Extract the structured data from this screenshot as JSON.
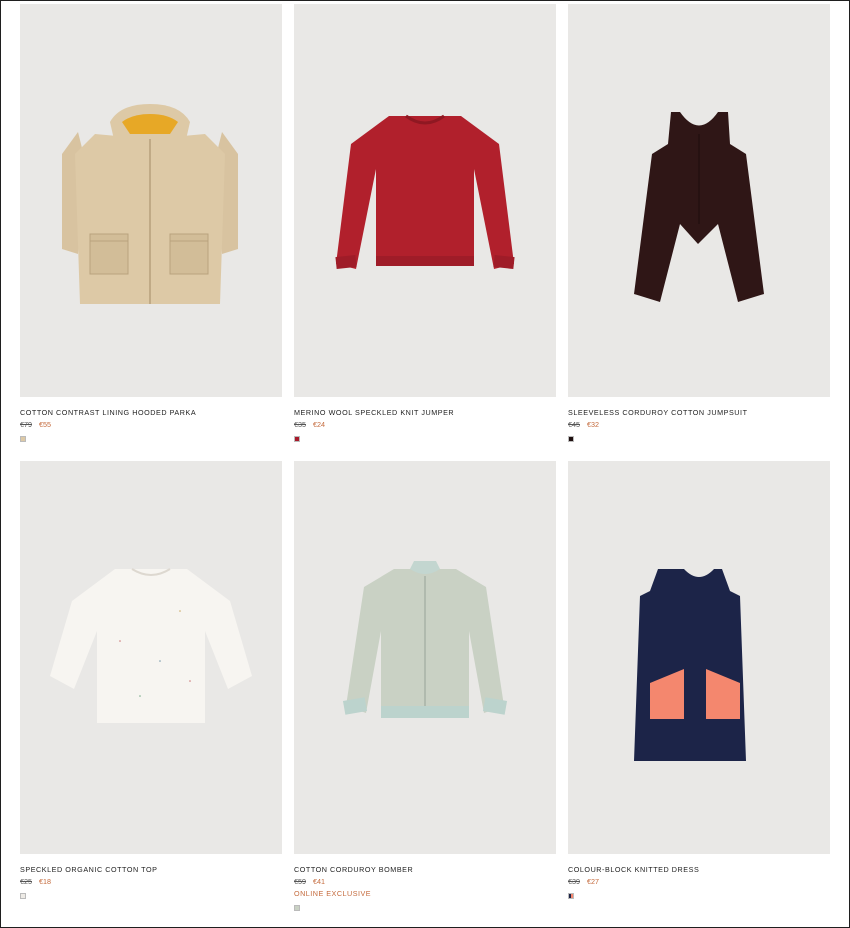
{
  "products": [
    {
      "name": "COTTON CONTRAST LINING HOODED PARKA",
      "old_price": "€79",
      "new_price": "€55",
      "badge": "",
      "swatch": "#ddc9a6",
      "icon": "parka-image"
    },
    {
      "name": "MERINO WOOL SPECKLED KNIT JUMPER",
      "old_price": "€35",
      "new_price": "€24",
      "badge": "",
      "swatch": "#a8192a",
      "icon": "jumper-image"
    },
    {
      "name": "SLEEVELESS CORDUROY COTTON JUMPSUIT",
      "old_price": "€45",
      "new_price": "€32",
      "badge": "",
      "swatch": "#1e0f0f",
      "icon": "jumpsuit-image"
    },
    {
      "name": "SPECKLED ORGANIC COTTON TOP",
      "old_price": "€25",
      "new_price": "€18",
      "badge": "",
      "swatch": "#eeebe6",
      "icon": "top-image"
    },
    {
      "name": "COTTON CORDUROY BOMBER",
      "old_price": "€59",
      "new_price": "€41",
      "badge": "ONLINE EXCLUSIVE",
      "swatch": "#c9d1c4",
      "icon": "bomber-image"
    },
    {
      "name": "COLOUR-BLOCK KNITTED DRESS",
      "old_price": "€39",
      "new_price": "€27",
      "badge": "",
      "swatch": "#1c2448",
      "icon": "dress-image"
    }
  ],
  "colors": {
    "sale": "#c46a3c",
    "image_bg": "#e9e8e6"
  }
}
